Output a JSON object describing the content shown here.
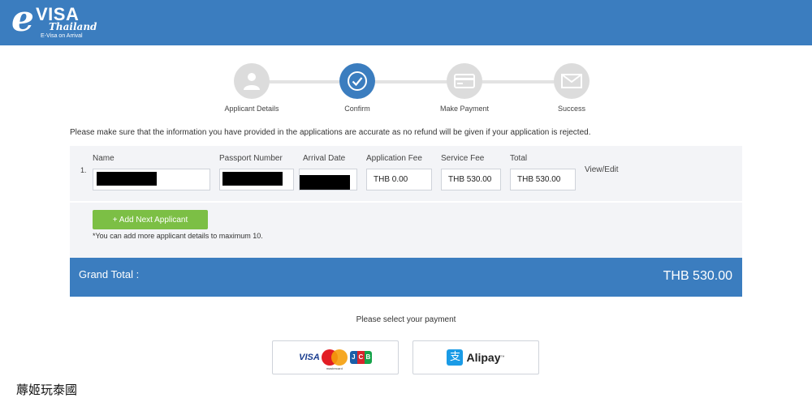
{
  "brand": {
    "logo_e": "e",
    "logo_visa": "VISA",
    "logo_thailand": "Thailand",
    "logo_subtitle": "E-Visa on Arrival"
  },
  "colors": {
    "brand_blue": "#3b7dbf",
    "add_button_green": "#7cbf45",
    "step_inactive": "#dcdcdc",
    "panel_bg": "#f3f4f7"
  },
  "steps": [
    {
      "label": "Applicant Details",
      "icon": "user-icon",
      "active": false
    },
    {
      "label": "Confirm",
      "icon": "check-circle-icon",
      "active": true
    },
    {
      "label": "Make Payment",
      "icon": "credit-card-icon",
      "active": false
    },
    {
      "label": "Success",
      "icon": "envelope-icon",
      "active": false
    }
  ],
  "notice": "Please make sure that the information you have provided in the applications are accurate as no refund will be given if your application is rejected.",
  "table": {
    "headers": {
      "name": "Name",
      "passport": "Passport Number",
      "arrival": "Arrival Date",
      "app_fee": "Application Fee",
      "service_fee": "Service Fee",
      "total": "Total"
    },
    "rows": [
      {
        "index": "1.",
        "application_fee": "THB 0.00",
        "service_fee": "THB 530.00",
        "total": "THB 530.00",
        "action": "View/Edit"
      }
    ]
  },
  "add_applicant": {
    "button_label": "+ Add Next Applicant",
    "note": "*You can add more applicant details to maximum 10."
  },
  "grand_total": {
    "label": "Grand Total :",
    "value": "THB 530.00"
  },
  "payment": {
    "prompt": "Please select your payment",
    "card_option": {
      "visa": "VISA",
      "mastercard": "mastercard",
      "jcb": [
        "J",
        "C",
        "B"
      ]
    },
    "alipay_option": {
      "icon_glyph": "支",
      "label": "Alipay",
      "tm": "™"
    }
  },
  "footer_text": "蓐姬玩泰國"
}
